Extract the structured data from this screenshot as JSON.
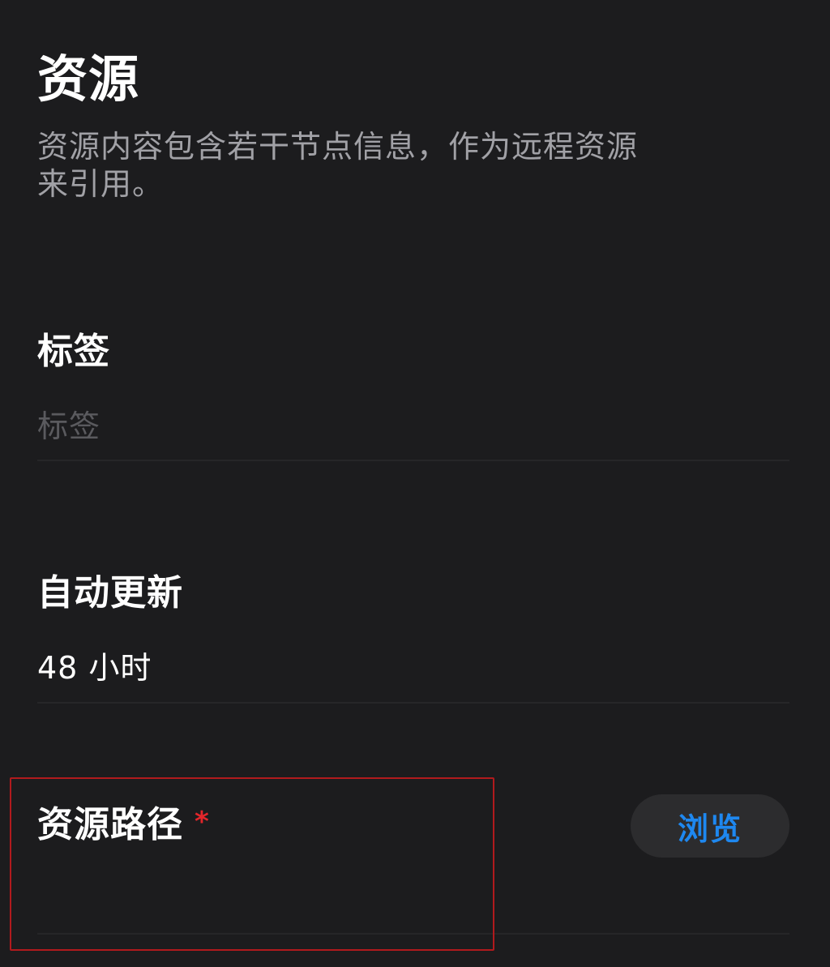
{
  "header": {
    "title": "资源",
    "description_line1": "资源内容包含若干节点信息，作为远程资源",
    "description_line2": "来引用。"
  },
  "tag_field": {
    "label": "标签",
    "value": "",
    "placeholder": "标签"
  },
  "auto_update_field": {
    "label": "自动更新",
    "value": "48 小时"
  },
  "resource_path_field": {
    "label": "资源路径",
    "required_mark": "*",
    "value": "",
    "browse_label": "浏览"
  },
  "colors": {
    "background": "#1c1c1e",
    "accent": "#1e88f0",
    "required": "#e3262b",
    "highlight_border": "#b11a1d"
  }
}
